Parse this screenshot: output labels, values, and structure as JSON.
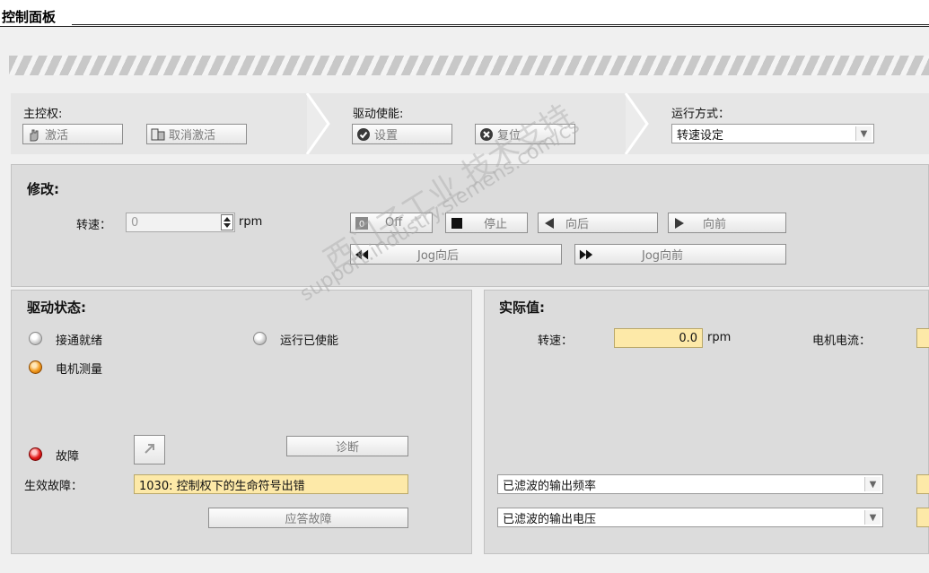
{
  "header": {
    "title": "控制面板"
  },
  "control": {
    "master": {
      "label": "主控权:",
      "activate": "激活",
      "deactivate": "取消激活"
    },
    "enable": {
      "label": "驱动使能:",
      "set": "设置",
      "reset": "复位"
    },
    "mode": {
      "label": "运行方式：",
      "value": "转速设定"
    }
  },
  "modify": {
    "title": "修改:",
    "speed_label": "转速：",
    "speed_value": "0",
    "speed_unit": "rpm",
    "off": "Off",
    "stop": "停止",
    "backward": "向后",
    "forward": "向前",
    "jog_backward": "Jog向后",
    "jog_forward": "Jog向前"
  },
  "status": {
    "title": "驱动状态:",
    "ready": "接通就绪",
    "running_enabled": "运行已使能",
    "motor_measure": "电机测量",
    "fault": "故障",
    "diagnose": "诊断",
    "active_fault_label": "生效故障：",
    "active_fault_value": "1030: 控制权下的生命符号出错",
    "acknowledge": "应答故障"
  },
  "actual": {
    "title": "实际值:",
    "speed_label": "转速：",
    "speed_value": "0.0",
    "speed_unit": "rpm",
    "current_label": "电机电流：",
    "select1": "已滤波的输出频率",
    "select2": "已滤波的输出电压"
  },
  "watermark": {
    "line1": "西门子工业 技术支持",
    "line2": "support.industry.siemens.com/cs"
  },
  "colors": {
    "value_field": "#fde9a8",
    "led_orange": "#f29a1d",
    "led_red": "#e41b1b"
  }
}
